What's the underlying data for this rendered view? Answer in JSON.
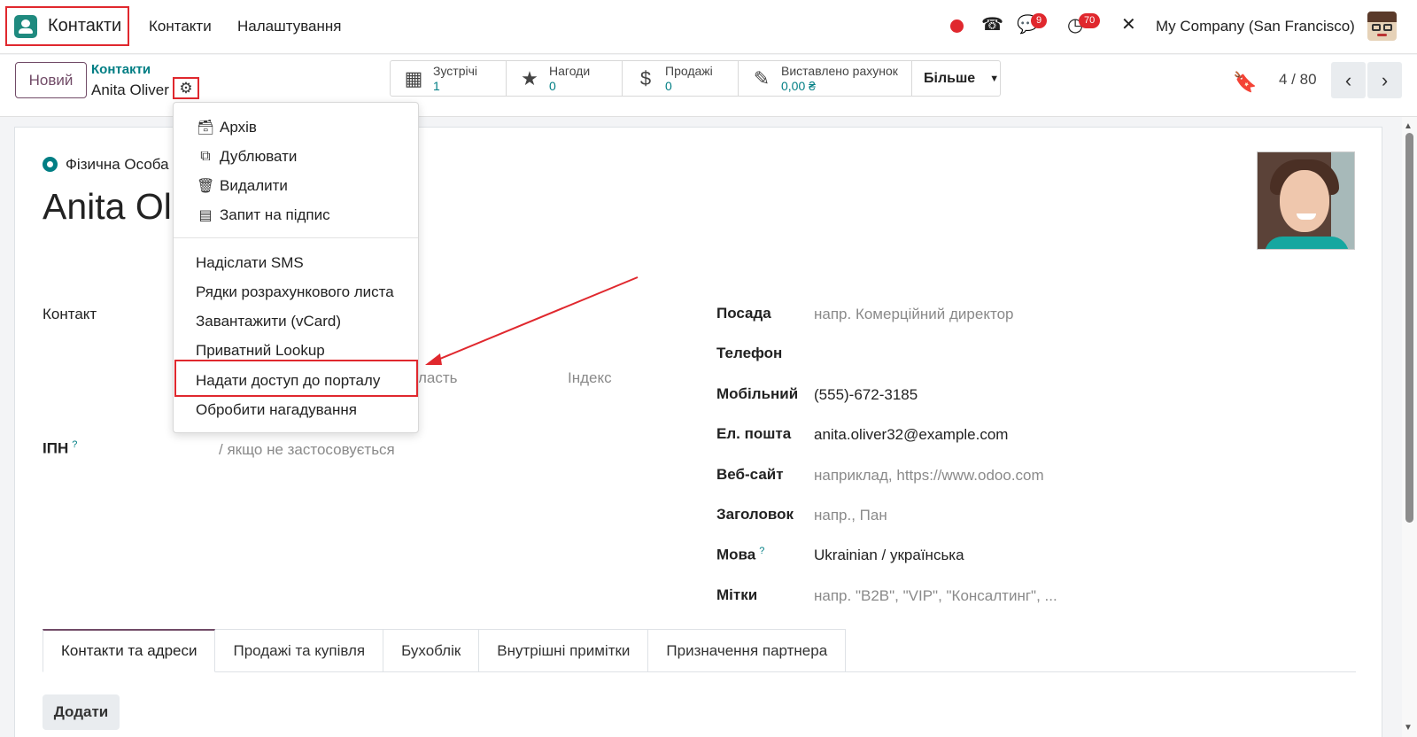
{
  "navbar": {
    "app_name": "Контакти",
    "menu": [
      "Контакти",
      "Налаштування"
    ],
    "messages_count": "9",
    "activities_count": "70",
    "company": "My Company (San Francisco)"
  },
  "control_panel": {
    "new_button": "Новий",
    "breadcrumb_parent": "Контакти",
    "breadcrumb_current": "Anita Oliver",
    "smart_buttons": [
      {
        "label": "Зустрічі",
        "value": "1",
        "icon": "calendar-icon"
      },
      {
        "label": "Нагоди",
        "value": "0",
        "icon": "star-icon"
      },
      {
        "label": "Продажі",
        "value": "0",
        "icon": "dollar-icon"
      },
      {
        "label": "Виставлено рахунок",
        "value": "0,00 ₴",
        "icon": "edit-icon"
      }
    ],
    "more_button": "Більше",
    "pager": "4 / 80"
  },
  "gear_menu": {
    "items_with_icons": [
      {
        "label": "Архів",
        "icon": "archive-icon"
      },
      {
        "label": "Дублювати",
        "icon": "duplicate-icon"
      },
      {
        "label": "Видалити",
        "icon": "trash-icon"
      },
      {
        "label": "Запит на підпис",
        "icon": "document-icon"
      }
    ],
    "items": [
      "Надіслати SMS",
      "Рядки розрахункового листа",
      "Завантажити (vCard)",
      "Приватний Lookup",
      "Надати доступ до порталу",
      "Обробити нагадування"
    ]
  },
  "form": {
    "company_type": "Фізична Особа",
    "name": "Anita Ol",
    "contact_label": "Контакт",
    "region_partial": "ласть",
    "zip_placeholder": "Індекс",
    "tax_label": "ІПН",
    "tax_help": "?",
    "tax_placeholder": "/ якщо не застосовується",
    "right_fields": [
      {
        "label": "Посада",
        "value": "напр. Комерційний директор",
        "placeholder": true
      },
      {
        "label": "Телефон",
        "value": "",
        "placeholder": false
      },
      {
        "label": "Мобільний",
        "value": "(555)-672-3185",
        "placeholder": false
      },
      {
        "label": "Ел. пошта",
        "value": "anita.oliver32@example.com",
        "placeholder": false
      },
      {
        "label": "Веб-сайт",
        "value": "наприклад, https://www.odoo.com",
        "placeholder": true
      },
      {
        "label": "Заголовок",
        "value": "напр., Пан",
        "placeholder": true
      },
      {
        "label": "Мова",
        "value": "Ukrainian / українська",
        "placeholder": false,
        "help": "?"
      },
      {
        "label": "Мітки",
        "value": "напр. \"B2B\", \"VIP\", \"Консалтинг\", ...",
        "placeholder": true
      }
    ],
    "tabs": [
      "Контакти та адреси",
      "Продажі та купівля",
      "Бухоблік",
      "Внутрішні примітки",
      "Призначення партнера"
    ],
    "add_button": "Додати"
  },
  "colors": {
    "accent": "#714b67",
    "teal": "#017e84",
    "highlight": "#e0282e"
  }
}
